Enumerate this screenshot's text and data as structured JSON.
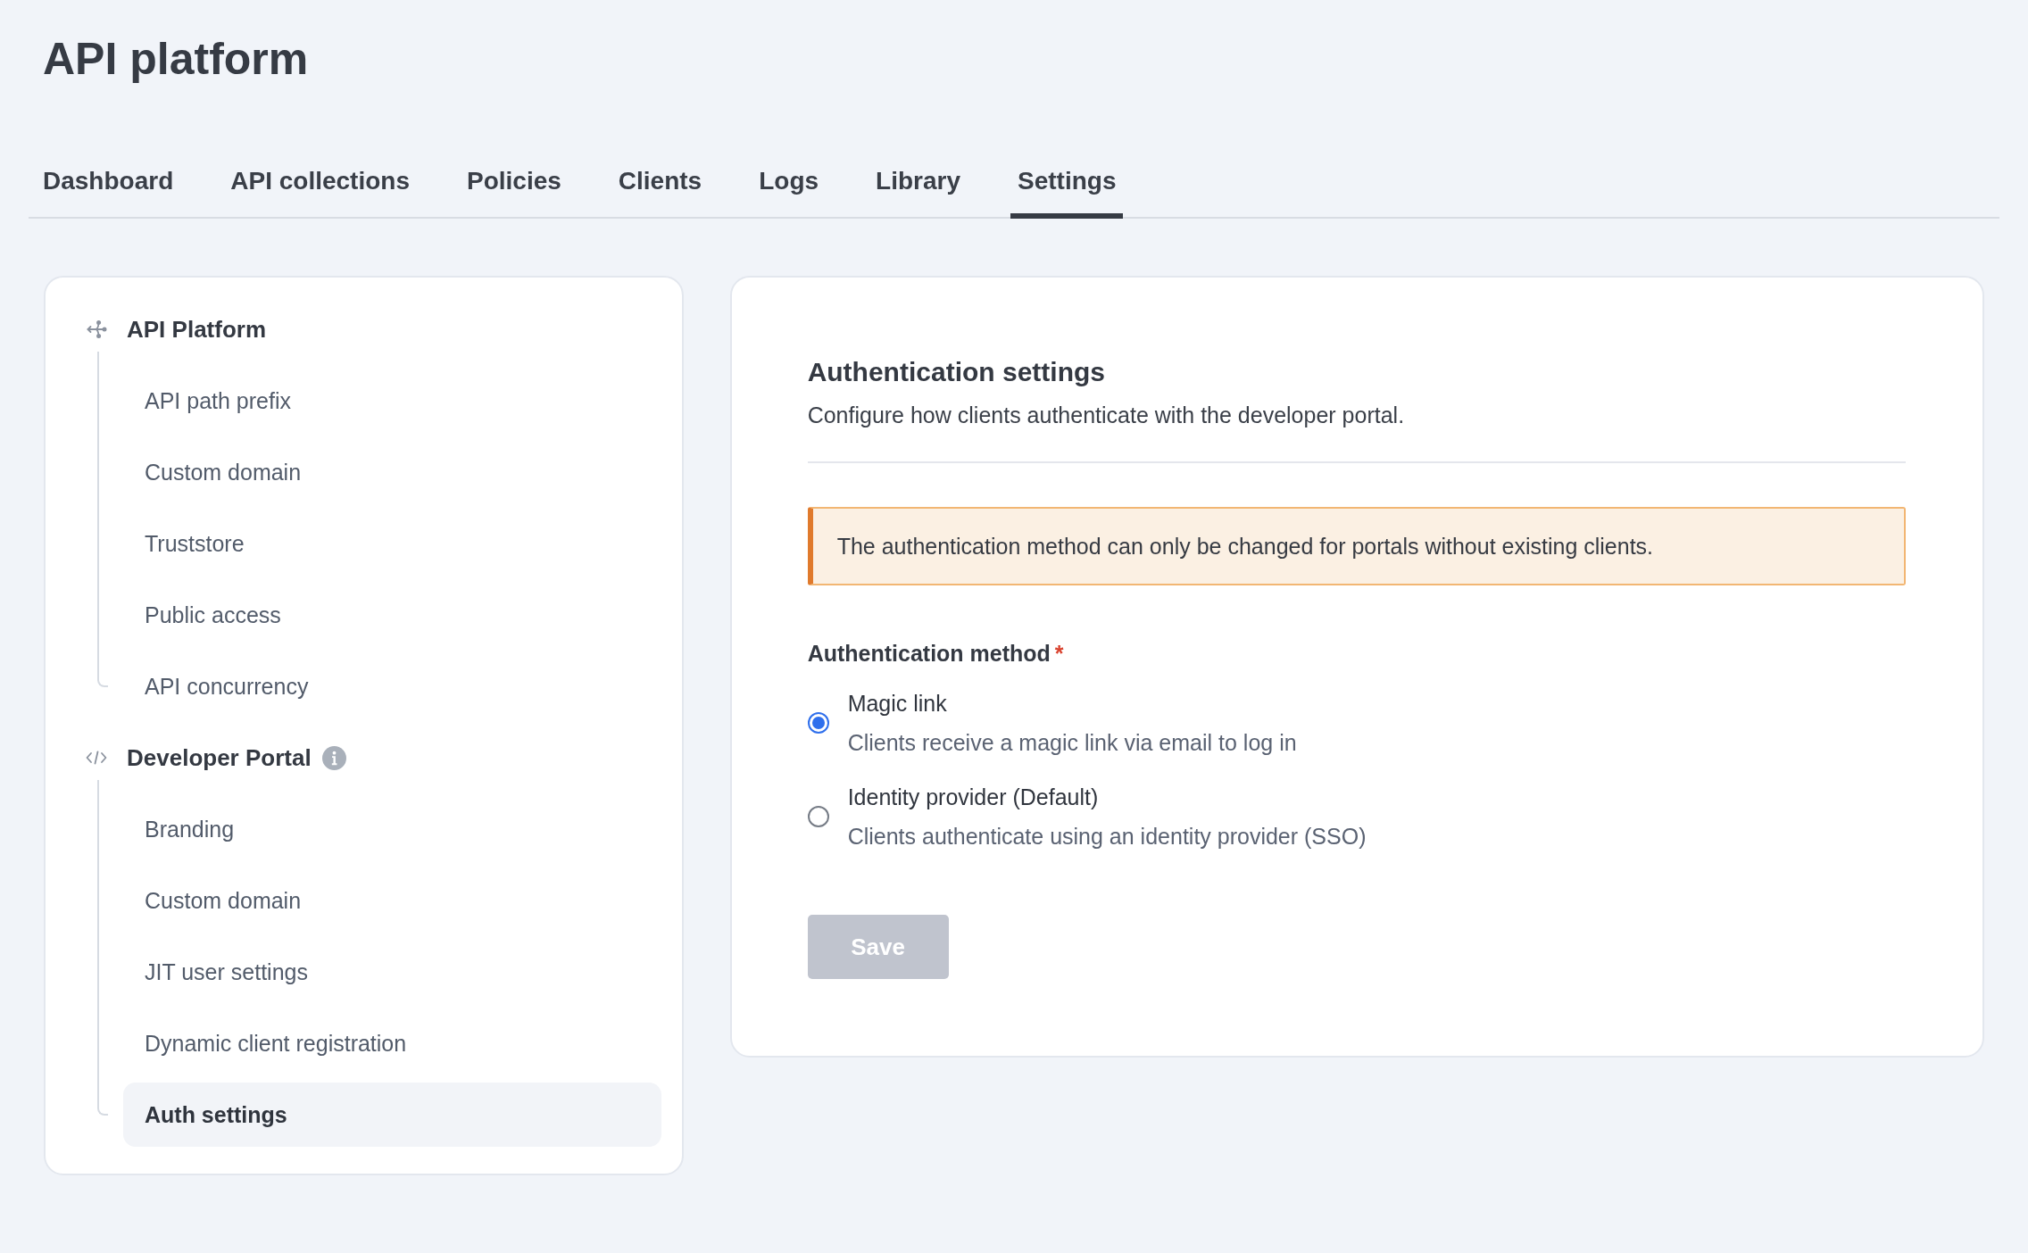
{
  "page": {
    "title": "API platform"
  },
  "tabs": [
    {
      "label": "Dashboard",
      "selected": false
    },
    {
      "label": "API collections",
      "selected": false
    },
    {
      "label": "Policies",
      "selected": false
    },
    {
      "label": "Clients",
      "selected": false
    },
    {
      "label": "Logs",
      "selected": false
    },
    {
      "label": "Library",
      "selected": false
    },
    {
      "label": "Settings",
      "selected": true
    }
  ],
  "sidebar": {
    "sections": [
      {
        "kind": "platform",
        "label": "API Platform",
        "info": false,
        "children": [
          {
            "label": "API path prefix",
            "selected": false
          },
          {
            "label": "Custom domain",
            "selected": false
          },
          {
            "label": "Truststore",
            "selected": false
          },
          {
            "label": "Public access",
            "selected": false
          },
          {
            "label": "API concurrency",
            "selected": false
          }
        ]
      },
      {
        "kind": "portal",
        "label": "Developer Portal",
        "info": true,
        "children": [
          {
            "label": "Branding",
            "selected": false
          },
          {
            "label": "Custom domain",
            "selected": false
          },
          {
            "label": "JIT user settings",
            "selected": false
          },
          {
            "label": "Dynamic client registration",
            "selected": false
          },
          {
            "label": "Auth settings",
            "selected": true
          }
        ]
      }
    ]
  },
  "panel": {
    "title": "Authentication settings",
    "description": "Configure how clients authenticate with the developer portal.",
    "alert": {
      "kind": "warning",
      "text": "The authentication method can only be changed for portals without existing clients."
    },
    "field": {
      "label": "Authentication method",
      "required_mark": "*",
      "options": [
        {
          "label": "Magic link",
          "description": "Clients receive a magic link via email to log in",
          "selected": true
        },
        {
          "label": "Identity provider (Default)",
          "description": "Clients authenticate using an identity provider (SSO)",
          "selected": false
        }
      ]
    },
    "save_button": {
      "label": "Save",
      "disabled": true
    }
  }
}
